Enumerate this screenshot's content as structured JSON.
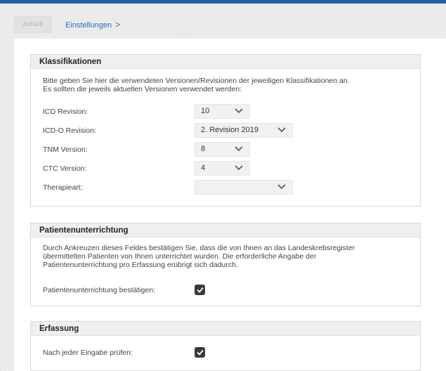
{
  "toolbar": {
    "back_label": "zurück",
    "breadcrumb_label": "Einstellungen",
    "breadcrumb_chevron": ">"
  },
  "klassifikationen": {
    "title": "Klassifikationen",
    "description_line1": "Bitte geben Sie hier die verwendeten Versionen/Revisionen der jeweiligen Klassifikationen an.",
    "description_line2": "Es sollten die jeweils aktuellen Versionen verwendet werden:",
    "rows": [
      {
        "label": "ICD Revision:",
        "value": "10"
      },
      {
        "label": "ICD-O Revision:",
        "value": "2. Revision 2019"
      },
      {
        "label": "TNM Version:",
        "value": "8"
      },
      {
        "label": "CTC Version:",
        "value": "4"
      },
      {
        "label": "Therapieart:",
        "value": ""
      }
    ]
  },
  "patientenunterrichtung": {
    "title": "Patientenunterrichtung",
    "description_line1": "Durch Ankreuzen dieses Feldes bestätigen Sie, dass die von Ihnen an das Landeskrebsregister",
    "description_line2": "übermittelten Patienten von Ihnen unterrichtet wurden. Die erforderliche Angabe der",
    "description_line3": "Patientenunterrichtung pro Erfassung erübrigt sich dadurch.",
    "confirm_label": "Patientenunterrichtung bestätigen:",
    "confirm_checked": true
  },
  "erfassung": {
    "title": "Erfassung",
    "check_label": "Nach jeder Eingabe prüfen:",
    "check_checked": true
  },
  "colors": {
    "topbar": "#1f5fa8",
    "link": "#1f6fc0",
    "checkbox": "#3a3a3a"
  }
}
